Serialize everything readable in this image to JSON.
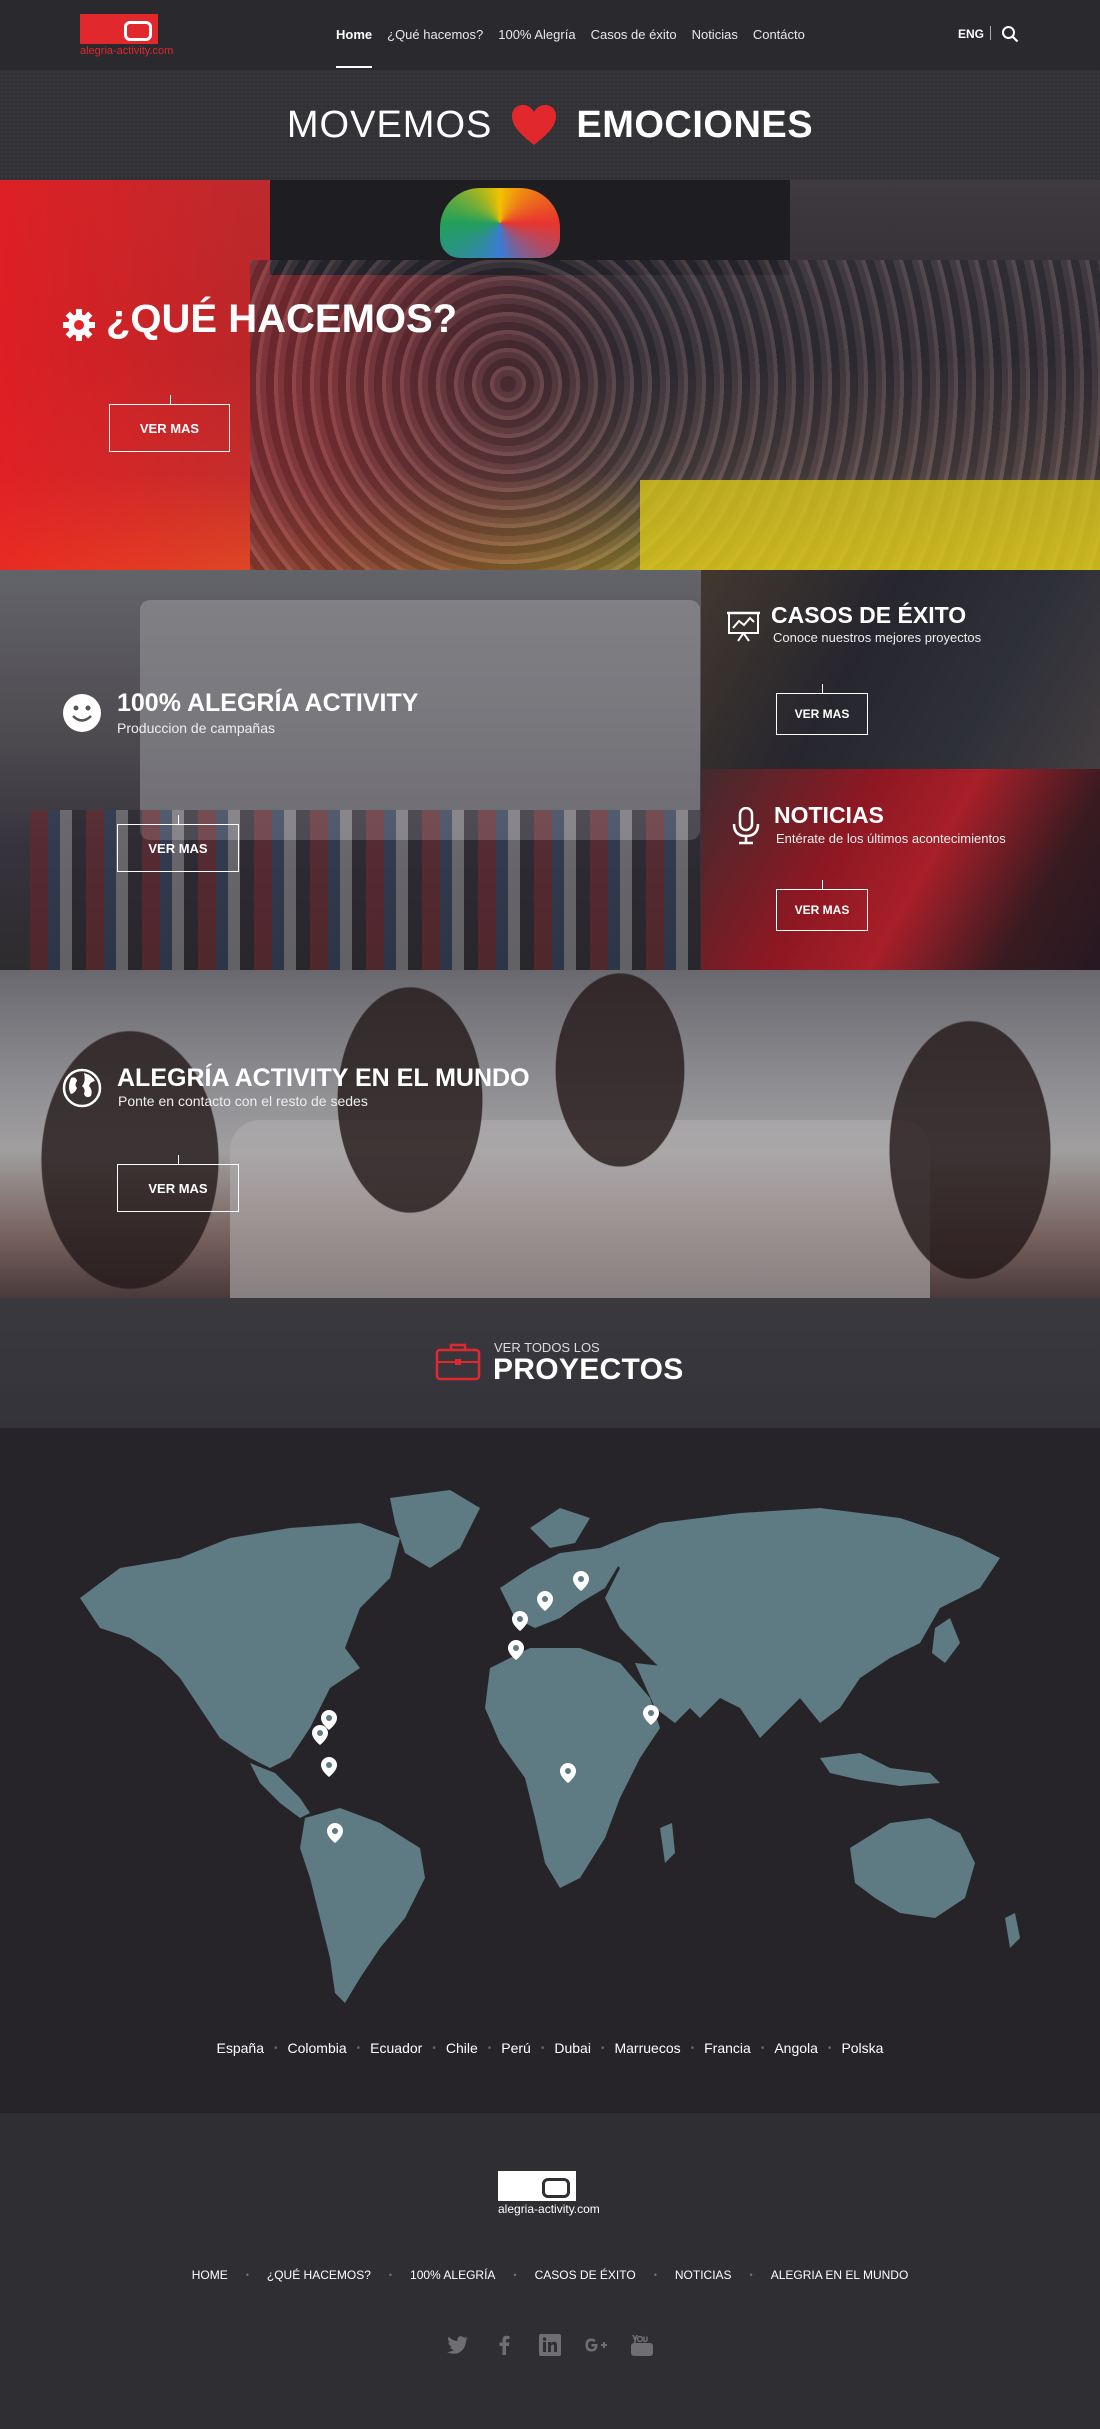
{
  "brand": {
    "url": "alegria-activity.com"
  },
  "nav": {
    "items": [
      "Home",
      "¿Qué hacemos?",
      "100% Alegría",
      "Casos de éxito",
      "Noticias",
      "Contácto"
    ],
    "lang": "ENG"
  },
  "tagline": {
    "part1": "MOVEMOS",
    "part2": "EMOCIONES"
  },
  "panels": {
    "que": {
      "title": "¿QUÉ HACEMOS?",
      "button": "VER MAS"
    },
    "alegria": {
      "title": "100% ALEGRÍA ACTIVITY",
      "subtitle": "Produccion de campañas",
      "button": "VER MAS"
    },
    "casos": {
      "title": "CASOS DE ÉXITO",
      "subtitle": "Conoce nuestros mejores proyectos",
      "button": "VER MAS"
    },
    "noticias": {
      "title": "NOTICIAS",
      "subtitle": "Entérate de los últimos acontecimientos",
      "button": "VER MAS"
    },
    "mundo": {
      "title": "ALEGRÍA ACTIVITY EN EL MUNDO",
      "subtitle": "Ponte en contacto con el resto de sedes",
      "button": "VER MAS"
    }
  },
  "projects": {
    "small": "VER TODOS LOS",
    "big": "PROYECTOS"
  },
  "countries": [
    "España",
    "Colombia",
    "Ecuador",
    "Chile",
    "Perú",
    "Dubai",
    "Marruecos",
    "Francia",
    "Angola",
    "Polska"
  ],
  "footer": {
    "url": "alegria-activity.com",
    "menu": [
      "HOME",
      "¿QUÉ HACEMOS?",
      "100% ALEGRÍA",
      "CASOS DE ÉXITO",
      "NOTICIAS",
      "ALEGRIA EN EL MUNDO"
    ],
    "social": [
      "twitter-icon",
      "facebook-icon",
      "linkedin-icon",
      "google-plus-icon",
      "youtube-icon"
    ]
  },
  "colors": {
    "brand_red": "#e0282d",
    "map_land": "#5e7a82",
    "background": "#262428"
  }
}
